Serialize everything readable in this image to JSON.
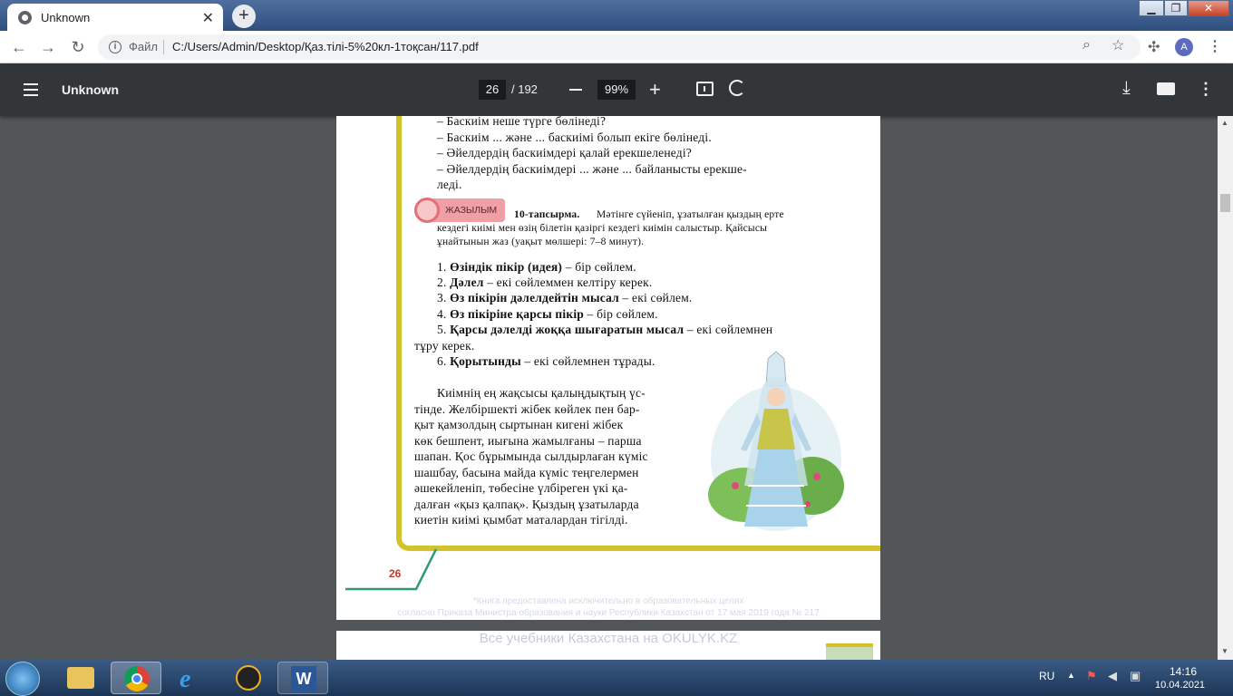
{
  "browser": {
    "tab_title": "Unknown",
    "new_tab": "+",
    "omnibox": {
      "scheme_label": "Файл",
      "url": "C:/Users/Admin/Desktop/Қаз.тілі-5%20кл-1тоқсан/117.pdf"
    },
    "avatar_letter": "A"
  },
  "pdf_toolbar": {
    "title": "Unknown",
    "page_current": "26",
    "page_total": "/ 192",
    "zoom": "99%"
  },
  "page": {
    "lines_top": [
      "– Баскиім неше түрге бөлінеді?",
      "– Баскиім ... және ... баскиімі болып екіге бөлінеді.",
      "– Әйелдердің баскиімдері қалай ерекшеленеді?",
      "– Әйелдердің баскиімдері ... және ... байланысты ерекше-",
      "леді."
    ],
    "badge": "ЖАЗЫЛЫМ",
    "task_heading": "10-тапсырма.",
    "task_text": [
      "Мәтінге сүйеніп, ұзатылған қыздың ерте",
      "кездегі киімі мен өзің білетін қазіргі кездегі киімін салыстыр. Қайсысы",
      "ұнайтынын жаз (уақыт мөлшері: 7–8 минут)."
    ],
    "list": [
      {
        "num": "1.",
        "bold": "Өзіндік пікір (идея)",
        "rest": " – бір сөйлем."
      },
      {
        "num": "2.",
        "bold": "Дәлел",
        "rest": " – екі сөйлеммен келтіру керек."
      },
      {
        "num": "3.",
        "bold": "Өз пікірін дәлелдейтін мысал",
        "rest": " – екі сөйлем."
      },
      {
        "num": "4.",
        "bold": "Өз пікіріне қарсы пікір",
        "rest": " – бір сөйлем."
      },
      {
        "num": "5.",
        "bold": "Қарсы дәлелді жоққа шығаратын мысал",
        "rest": " – екі сөйлемнен"
      },
      {
        "num": "",
        "bold": "",
        "rest": "тұру керек."
      },
      {
        "num": "6.",
        "bold": "Қорытынды",
        "rest": " – екі сөйлемнен тұрады."
      }
    ],
    "paragraph": [
      "Киімнің ең жақсысы қалыңдықтың үс-",
      "тінде. Желбіршекті жібек көйлек пен бар-",
      "қыт қамзолдың сыртынан кигені жібек",
      "көк бешпент, иығына жамылғаны – парша",
      "шапан. Қос бұрымында сылдырлаған күміс",
      "шашбау, басына майда күміс теңгелермен",
      "әшекейленіп, төбесіне үлбіреген үкі қа-",
      "далған «қыз қалпақ». Қыздың ұзатыларда",
      "киетін киімі қымбат маталардан тігілді."
    ],
    "page_number": "26",
    "watermark_line1": "*Книга предоставлена исключительно в образовательных целях",
    "watermark_line2": "согласно Приказа Министра образования и науки Республики Казахстан от 17 мая 2019 года № 217",
    "next_page_banner": "Все учебники Казахстана на OKULYK.KZ"
  },
  "taskbar": {
    "lang": "RU",
    "time": "14:16",
    "date": "10.04.2021"
  }
}
